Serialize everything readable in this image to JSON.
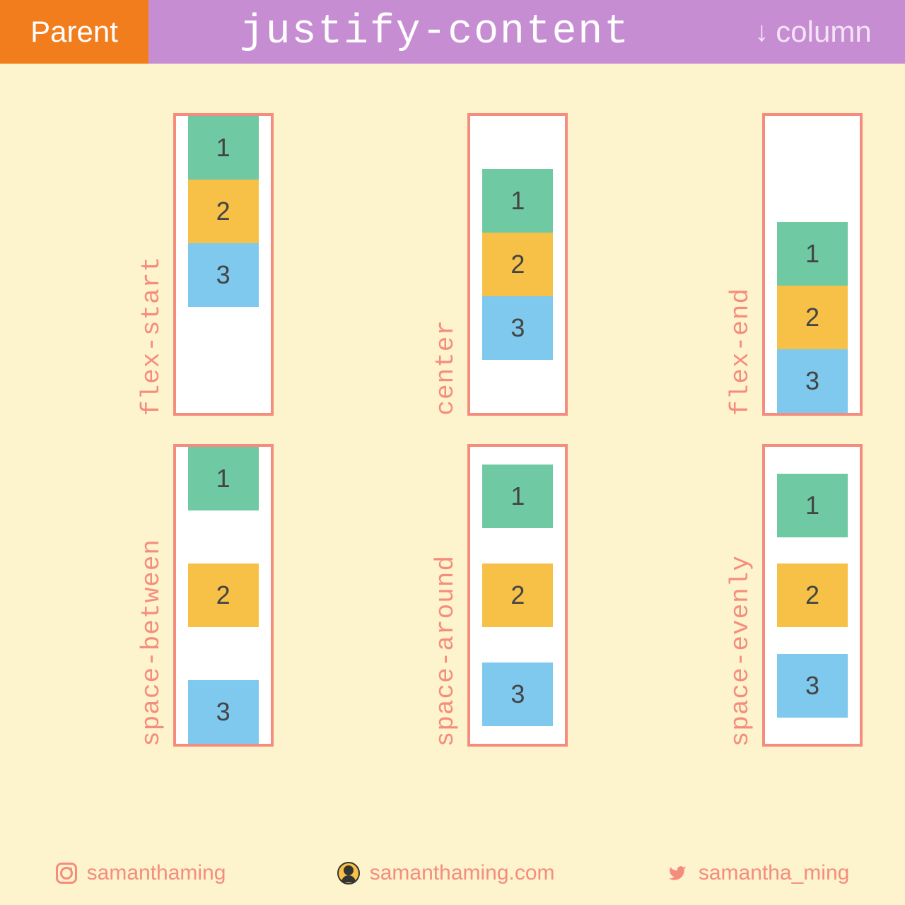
{
  "header": {
    "parent": "Parent",
    "title": "justify-content",
    "direction": "column",
    "arrow": "↓"
  },
  "examples": [
    {
      "label": "flex-start",
      "justify": "flex-start",
      "items": [
        "1",
        "2",
        "3"
      ]
    },
    {
      "label": "center",
      "justify": "center",
      "items": [
        "1",
        "2",
        "3"
      ]
    },
    {
      "label": "flex-end",
      "justify": "flex-end",
      "items": [
        "1",
        "2",
        "3"
      ]
    },
    {
      "label": "space-between",
      "justify": "space-between",
      "items": [
        "1",
        "2",
        "3"
      ]
    },
    {
      "label": "space-around",
      "justify": "space-around",
      "items": [
        "1",
        "2",
        "3"
      ]
    },
    {
      "label": "space-evenly",
      "justify": "space-evenly",
      "items": [
        "1",
        "2",
        "3"
      ]
    }
  ],
  "footer": {
    "instagram": "samanthaming",
    "website": "samanthaming.com",
    "twitter": "samantha_ming"
  }
}
